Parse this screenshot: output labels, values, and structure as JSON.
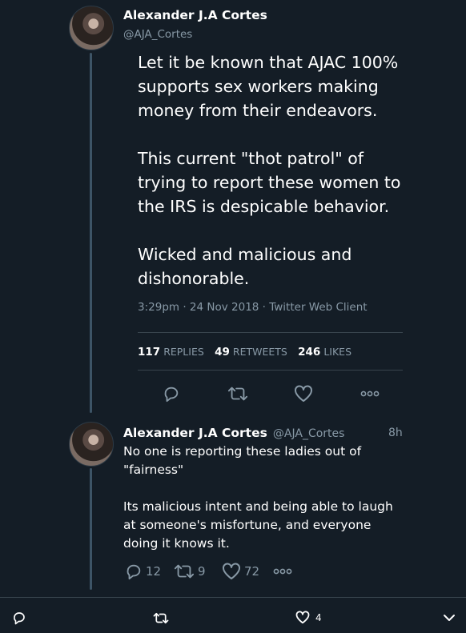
{
  "tweet": {
    "author_name": "Alexander J.A Cortes",
    "author_handle": "@AJA_Cortes",
    "text": "Let it be known that AJAC 100%\nsupports sex workers making\nmoney from their endeavors.\n\nThis current \"thot patrol\" of\ntrying to report these women to\nthe IRS is despicable behavior.\n\nWicked and malicious and\ndishonorable.",
    "timestamp": "3:29pm · 24 Nov 2018 · Twitter Web Client",
    "replies_count": "117",
    "replies_label": "REPLIES",
    "retweets_count": "49",
    "retweets_label": "RETWEETS",
    "likes_count": "246",
    "likes_label": "LIKES"
  },
  "reply": {
    "author_name": "Alexander J.A Cortes",
    "author_handle": "@AJA_Cortes",
    "time": "8h",
    "text": "No one is reporting these ladies out of\n\"fairness\"\n\nIts malicious intent and being able to laugh\nat someone's misfortune, and everyone\ndoing it knows it.",
    "reply_count": "12",
    "retweet_count": "9",
    "like_count": "72"
  },
  "bottom_bar": {
    "like_count": "4"
  },
  "colors": {
    "background": "#141d26",
    "secondary_text": "#8899a6",
    "divider": "#38444d",
    "thread_line": "#3d5466"
  },
  "icons": [
    "reply-icon",
    "retweet-icon",
    "like-icon",
    "more-icon",
    "chevron-down-icon"
  ]
}
